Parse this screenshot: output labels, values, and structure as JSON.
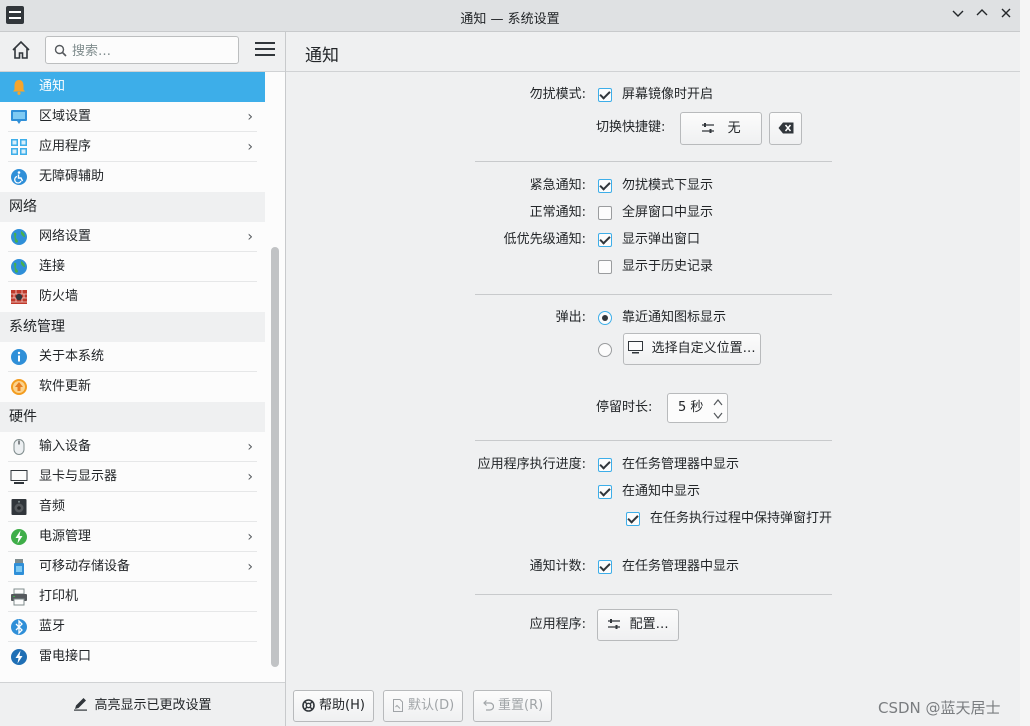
{
  "window": {
    "title": "通知 — 系统设置",
    "minimize_icon": "chevron-down-icon",
    "maximize_icon": "chevron-up-icon",
    "close_icon": "close-icon"
  },
  "sidebar": {
    "search_placeholder": "搜索…",
    "items": [
      {
        "label": "通知",
        "icon": "bell-icon",
        "selected": true
      },
      {
        "label": "区域设置",
        "icon": "region-icon",
        "chevron": true
      },
      {
        "label": "应用程序",
        "icon": "apps-icon",
        "chevron": true
      },
      {
        "label": "无障碍辅助",
        "icon": "accessibility-icon"
      }
    ],
    "categories": [
      {
        "title": "网络",
        "items": [
          {
            "label": "网络设置",
            "icon": "globe-icon",
            "chevron": true
          },
          {
            "label": "连接",
            "icon": "globe-icon"
          },
          {
            "label": "防火墙",
            "icon": "firewall-icon"
          }
        ]
      },
      {
        "title": "系统管理",
        "items": [
          {
            "label": "关于本系统",
            "icon": "info-icon"
          },
          {
            "label": "软件更新",
            "icon": "update-icon"
          }
        ]
      },
      {
        "title": "硬件",
        "items": [
          {
            "label": "输入设备",
            "icon": "mouse-icon",
            "chevron": true
          },
          {
            "label": "显卡与显示器",
            "icon": "monitor-icon",
            "chevron": true
          },
          {
            "label": "音频",
            "icon": "speaker-icon"
          },
          {
            "label": "电源管理",
            "icon": "power-icon",
            "chevron": true
          },
          {
            "label": "可移动存储设备",
            "icon": "usb-storage-icon",
            "chevron": true
          },
          {
            "label": "打印机",
            "icon": "printer-icon"
          },
          {
            "label": "蓝牙",
            "icon": "bluetooth-icon"
          },
          {
            "label": "雷电接口",
            "icon": "thunderbolt-icon"
          }
        ]
      }
    ],
    "footer_label": "高亮显示已更改设置"
  },
  "main": {
    "page_title": "通知",
    "dnd": {
      "label": "勿扰模式:",
      "option": "屏幕镜像时开启",
      "checked": true,
      "shortcut_label": "切换快捷键:",
      "shortcut_value": "无"
    },
    "critical": {
      "label": "紧急通知:",
      "option": "勿扰模式下显示",
      "checked": true
    },
    "normal": {
      "label": "正常通知:",
      "option": "全屏窗口中显示",
      "checked": false
    },
    "low": {
      "label": "低优先级通知:",
      "option1": "显示弹出窗口",
      "checked1": true,
      "option2": "显示于历史记录",
      "checked2": false
    },
    "popup": {
      "label": "弹出:",
      "option1": "靠近通知图标显示",
      "option2_button": "选择自定义位置…",
      "selected": 1
    },
    "duration": {
      "label": "停留时长:",
      "value": "5 秒"
    },
    "progress": {
      "label": "应用程序执行进度:",
      "option1": "在任务管理器中显示",
      "checked1": true,
      "option2": "在通知中显示",
      "checked2": true,
      "option3": "在任务执行过程中保持弹窗打开",
      "checked3": true
    },
    "badges": {
      "label": "通知计数:",
      "option": "在任务管理器中显示",
      "checked": true
    },
    "apps": {
      "label": "应用程序:",
      "button": "配置…"
    }
  },
  "bottombar": {
    "help": "帮助(H)",
    "defaults": "默认(D)",
    "reset": "重置(R)"
  },
  "watermark": "CSDN @蓝天居士",
  "colors": {
    "accent": "#3daee9",
    "background": "#eff0f1",
    "sidebar_bg": "#fcfcfc"
  }
}
